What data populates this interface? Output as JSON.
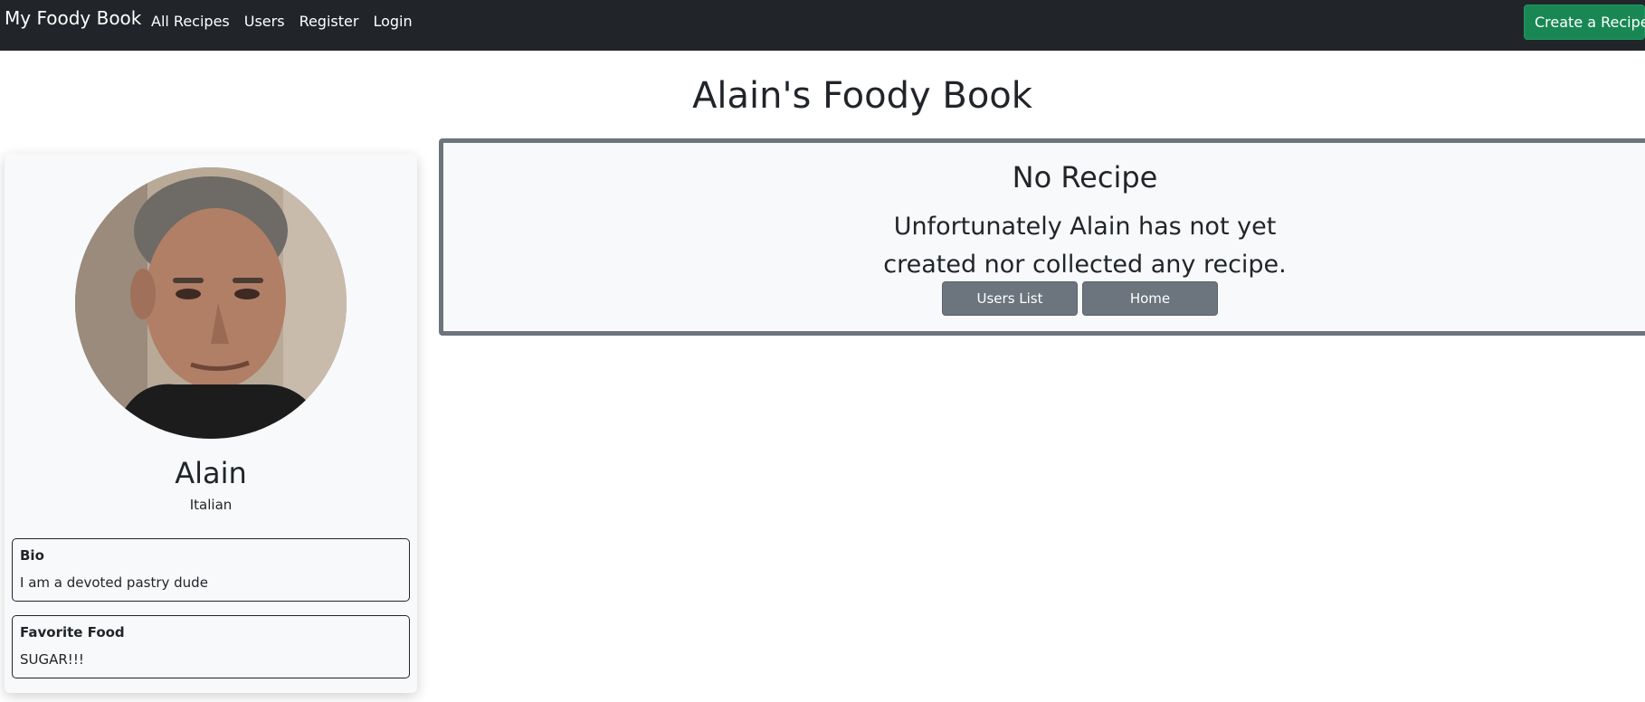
{
  "navbar": {
    "brand": "My Foody Book",
    "links": [
      "All Recipes",
      "Users",
      "Register",
      "Login"
    ],
    "create_button": "Create a Recipe",
    "colors": {
      "background": "#212529",
      "create_button": "#198754"
    }
  },
  "page": {
    "title": "Alain's Foody Book"
  },
  "profile": {
    "avatar_icon": "user-photo",
    "name": "Alain",
    "nationality": "Italian",
    "bio_label": "Bio",
    "bio": "I am a devoted pastry dude",
    "favorite_food_label": "Favorite Food",
    "favorite_food": "SUGAR!!!"
  },
  "empty_state": {
    "title": "No Recipe",
    "message_line1": "Unfortunately Alain has not yet",
    "message_line2": "created nor collected any recipe.",
    "buttons": [
      "Users List",
      "Home"
    ],
    "colors": {
      "border": "#6c757d",
      "button": "#6c757d"
    }
  }
}
